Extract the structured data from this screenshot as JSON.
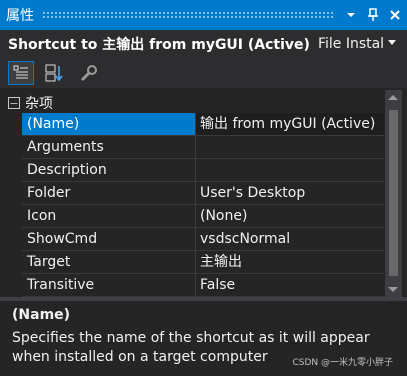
{
  "window": {
    "title": "属性",
    "buttons": {
      "dropdown": "▾",
      "pin": "📌",
      "close": "✕"
    }
  },
  "object_selector": {
    "name": "Shortcut to 主输出 from myGUI (Active)",
    "type": "File Instal",
    "arrow": "▾"
  },
  "toolbar": {
    "buttons": [
      "categorized-icon",
      "alphabetical-icon",
      "property-pages-icon"
    ],
    "active": "categorized-icon"
  },
  "grid": {
    "category": {
      "toggle": "−",
      "label": "杂项"
    },
    "rows": [
      {
        "name": "(Name)",
        "value": "输出 from myGUI (Active)",
        "selected": true
      },
      {
        "name": "Arguments",
        "value": ""
      },
      {
        "name": "Description",
        "value": ""
      },
      {
        "name": "Folder",
        "value": "User's Desktop"
      },
      {
        "name": "Icon",
        "value": "(None)"
      },
      {
        "name": "ShowCmd",
        "value": "vsdscNormal"
      },
      {
        "name": "Target",
        "value": "主输出"
      },
      {
        "name": "Transitive",
        "value": "False"
      }
    ]
  },
  "description": {
    "title": "(Name)",
    "text": "Specifies the name of the shortcut as it will appear when installed on a target computer"
  },
  "watermark": "CSDN @一米九零小胖子",
  "colors": {
    "accent": "#007acc",
    "background": "#252526",
    "panel": "#2d2d30",
    "text": "#f1f1f1"
  }
}
